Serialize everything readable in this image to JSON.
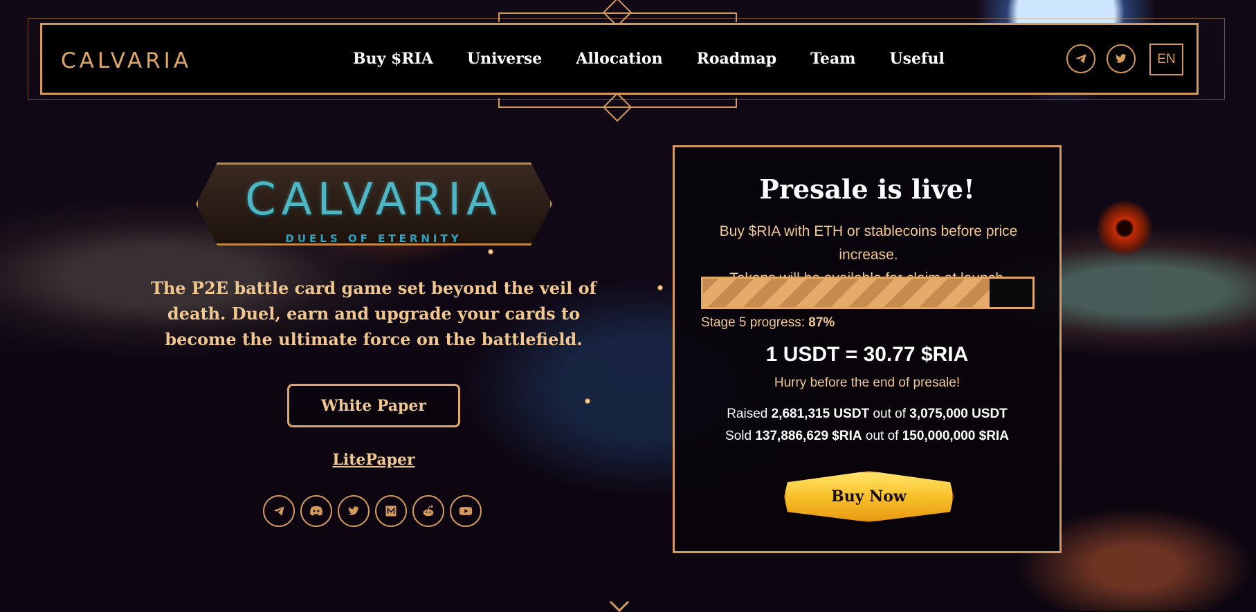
{
  "header": {
    "logo": "CALVARIA",
    "nav": [
      "Buy $RIA",
      "Universe",
      "Allocation",
      "Roadmap",
      "Team",
      "Useful"
    ],
    "language": "EN",
    "icons": [
      "telegram-icon",
      "twitter-icon"
    ]
  },
  "hero": {
    "logo_title": "CALVARIA",
    "logo_subtitle": "DUELS OF ETERNITY",
    "tagline": "The P2E battle card game set beyond the veil of death. Duel, earn and upgrade your cards to become the ultimate force on the battlefield.",
    "white_paper_label": "White Paper",
    "litepaper_label": "LitePaper",
    "socials": [
      "telegram-icon",
      "discord-icon",
      "twitter-icon",
      "medium-icon",
      "reddit-icon",
      "youtube-icon"
    ]
  },
  "presale": {
    "title": "Presale is live!",
    "desc_line1": "Buy $RIA with ETH or stablecoins before price increase.",
    "desc_line2": "Tokens will be available for claim at launch.",
    "progress_percent": 87,
    "stage_label": "Stage 5 progress: ",
    "stage_value": "87%",
    "rate": "1 USDT = 30.77 $RIA",
    "hurry": "Hurry before the end of presale!",
    "raised_label": "Raised",
    "raised_value": "2,681,315 USDT",
    "out_of": "out of",
    "raised_total": "3,075,000 USDT",
    "sold_label": "Sold",
    "sold_value": "137,886,629 $RIA",
    "sold_total": "150,000,000 $RIA",
    "buy_label": "Buy Now"
  },
  "colors": {
    "accent": "#d39a5c",
    "text_gold": "#f0c78f",
    "button_yellow": "#f8c12a"
  }
}
